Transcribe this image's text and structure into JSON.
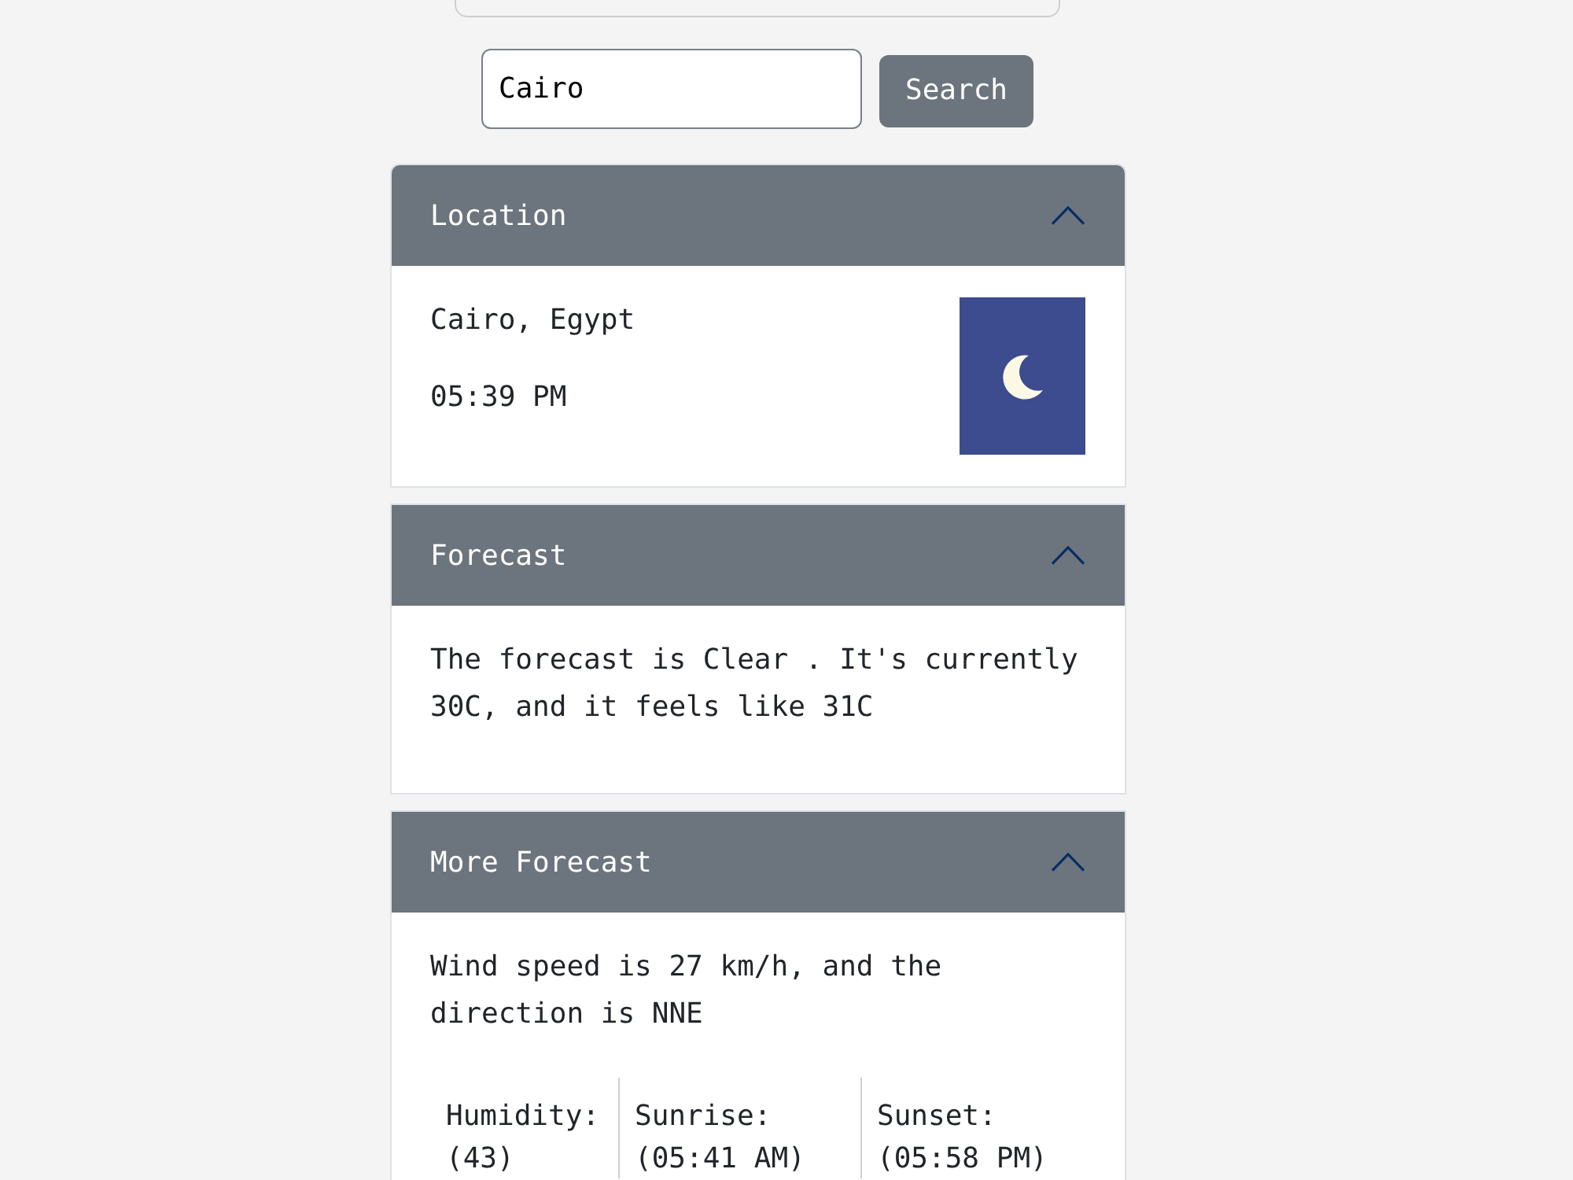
{
  "search": {
    "value": "Cairo",
    "button": "Search"
  },
  "accordion": [
    {
      "kind": "location",
      "title": "Location",
      "expanded": true,
      "place": "Cairo, Egypt",
      "time": "05:39 PM"
    },
    {
      "kind": "text",
      "title": "Forecast",
      "expanded": true,
      "text": "The forecast is Clear . It's currently 30C, and it feels like 31C"
    },
    {
      "kind": "details",
      "title": "More Forecast",
      "expanded": true,
      "text": "Wind speed is 27 km/h, and the direction is NNE",
      "stats": [
        {
          "label": "Humidity:",
          "value": "(43)"
        },
        {
          "label": "Sunrise:",
          "value": "(05:41 AM)"
        },
        {
          "label": "Sunset:",
          "value": "(05:58 PM)"
        }
      ]
    }
  ]
}
